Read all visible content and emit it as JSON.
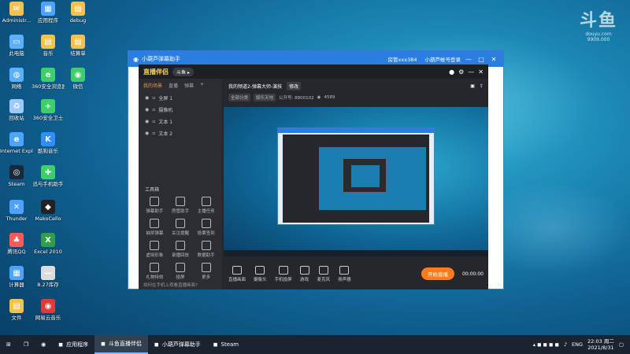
{
  "desktop": {
    "icons": [
      {
        "label": "Administr...",
        "color": "#f2c14e",
        "glyph": "✉"
      },
      {
        "label": "应用程序",
        "color": "#4da3ff",
        "glyph": "▦"
      },
      {
        "label": "debug",
        "color": "#f2c14e",
        "glyph": "▤"
      },
      {
        "label": "此电脑",
        "color": "#5ab0ff",
        "glyph": "▭"
      },
      {
        "label": "音乐",
        "color": "#f2c14e",
        "glyph": "▤"
      },
      {
        "label": "结算单",
        "color": "#f2c14e",
        "glyph": "▤"
      },
      {
        "label": "网络",
        "color": "#5ab0ff",
        "glyph": "◍"
      },
      {
        "label": "360安全浏览器",
        "color": "#3ecf6a",
        "glyph": "e"
      },
      {
        "label": "微信",
        "color": "#3ecf6a",
        "glyph": "◉"
      },
      {
        "label": "回收站",
        "color": "#9ec9ff",
        "glyph": "♻"
      },
      {
        "label": "360安全卫士",
        "color": "#3ecf6a",
        "glyph": "+"
      },
      {
        "label": "Internet Explorer",
        "color": "#4da3ff",
        "glyph": "e"
      },
      {
        "label": "酷狗音乐",
        "color": "#2f8fff",
        "glyph": "K"
      },
      {
        "label": "Steam",
        "color": "#1b2838",
        "glyph": "◎"
      },
      {
        "label": "迅与手机助手",
        "color": "#3ecf6a",
        "glyph": "✚"
      },
      {
        "label": "Thunder",
        "color": "#4da3ff",
        "glyph": "✕"
      },
      {
        "label": "MakoCello",
        "color": "#222",
        "glyph": "◆"
      },
      {
        "label": "腾讯QQ",
        "color": "#ff5a5a",
        "glyph": "♣"
      },
      {
        "label": "Excel 2010",
        "color": "#2e9e4f",
        "glyph": "X"
      },
      {
        "label": "计算器",
        "color": "#4da3ff",
        "glyph": "▦"
      },
      {
        "label": "8.27库存",
        "color": "#ddd",
        "glyph": "—"
      },
      {
        "label": "文件",
        "color": "#f2c14e",
        "glyph": "▤"
      },
      {
        "label": "网易云音乐",
        "color": "#e23a3a",
        "glyph": "◉"
      }
    ],
    "brand_logo": {
      "text": "斗鱼",
      "sub": "douyu.com",
      "id": "9909.000"
    }
  },
  "host_window": {
    "title": "小葫芦弹幕助手",
    "right_user": "房管xxx384",
    "right_action": "小葫芦帐号登录",
    "buttons": {
      "min": "—",
      "max": "□",
      "close": "✕"
    }
  },
  "app": {
    "logo": "直播伴侣",
    "badge": "斗鱼 ▸",
    "side_tabs": [
      "我的场景",
      "直播",
      "弹幕"
    ],
    "layers": [
      "全屏 1",
      "摄像机",
      "文本 1",
      "文本 2"
    ],
    "tools_heading": "工具箱",
    "tools": [
      "弹幕助手",
      "房管助手",
      "主播任务",
      "抽奖弹幕",
      "关注提醒",
      "投票签到",
      "虚拟形象",
      "录播回放",
      "数据助手",
      "礼物特效",
      "投屏",
      "更多"
    ],
    "footer": "如何在手机上观看直播画面?",
    "room_title": "我的频道2-弹幕大师-演技",
    "room_edit": "修改",
    "category": "全部分类",
    "category2": "娱乐天地",
    "room_id": "公开号: 8800102",
    "viewers": "4589",
    "controls": [
      "直播画面",
      "摄像头",
      "手机投屏",
      "游戏",
      "麦克风",
      "扬声器"
    ],
    "live_button": "开始直播",
    "timer": "00:00:00"
  },
  "taskbar": {
    "items": [
      "应用程序",
      "斗鱼直播伴侣",
      "小葫芦弹幕助手",
      "Steam"
    ],
    "lang": "ENG",
    "time": "22:03",
    "weekday": "周二",
    "date": "2021/8/31"
  }
}
